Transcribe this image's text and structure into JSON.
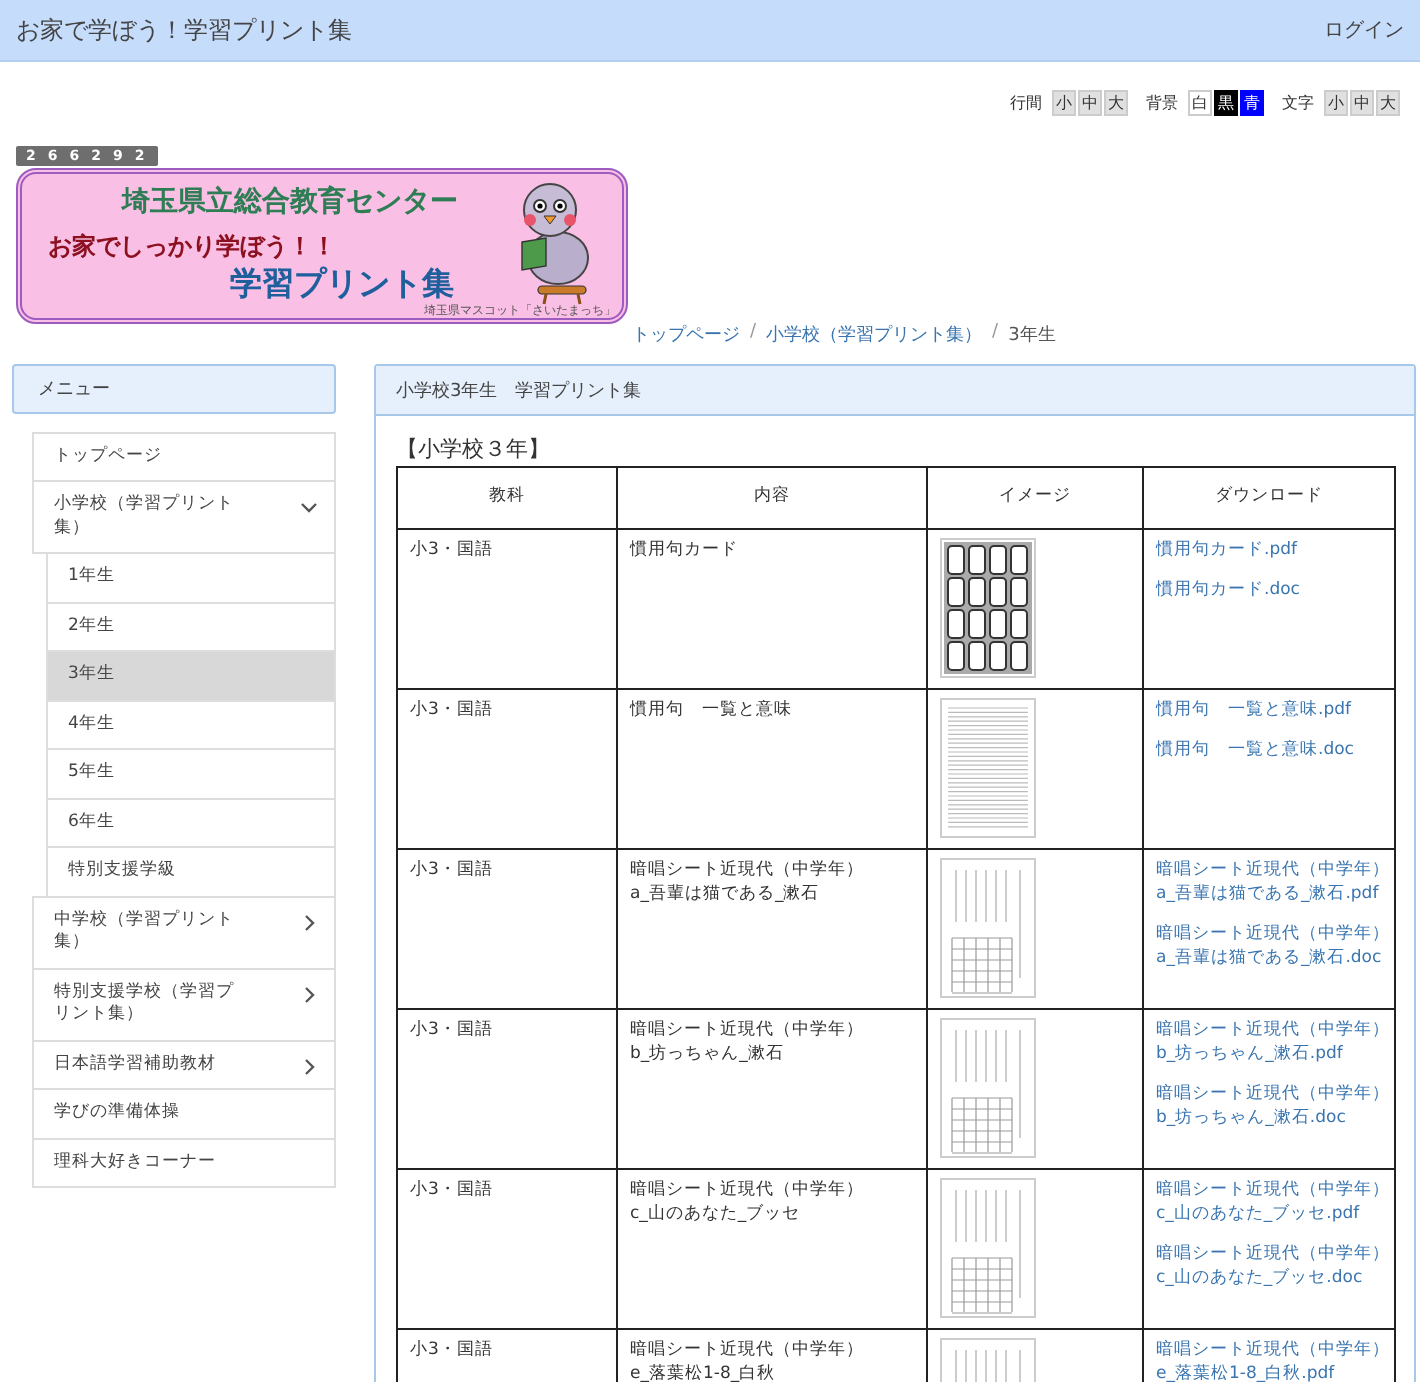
{
  "header": {
    "title": "お家で学ぼう！学習プリント集",
    "login": "ログイン"
  },
  "settings": [
    {
      "label": "行間",
      "options": [
        {
          "text": "小"
        },
        {
          "text": "中"
        },
        {
          "text": "大"
        }
      ]
    },
    {
      "label": "背景",
      "options": [
        {
          "text": "白",
          "color": "#ffffff"
        },
        {
          "text": "黒",
          "color": "#000000"
        },
        {
          "text": "青",
          "color": "#0000ff"
        }
      ]
    },
    {
      "label": "文字",
      "options": [
        {
          "text": "小"
        },
        {
          "text": "中"
        },
        {
          "text": "大"
        }
      ]
    }
  ],
  "counter": "266292",
  "banner": {
    "organization": "埼玉県立総合教育センター",
    "slogan": "お家でしっかり学ぼう！！",
    "title": "学習プリント集",
    "caption": "埼玉県マスコット「さいたまっち」"
  },
  "breadcrumb": {
    "separator": "/",
    "items": [
      "トップページ",
      "小学校（学習プリント集）",
      "3年生"
    ]
  },
  "sidebar": {
    "title": "メニュー",
    "items": [
      {
        "label": "トップページ",
        "kind": "link",
        "selected": false
      },
      {
        "label": "小学校（学習プリント集）",
        "kind": "group",
        "expanded": true,
        "selected": false,
        "children": [
          {
            "label": "1年生",
            "kind": "link",
            "selected": false
          },
          {
            "label": "2年生",
            "kind": "link",
            "selected": false
          },
          {
            "label": "3年生",
            "kind": "link",
            "selected": true
          },
          {
            "label": "4年生",
            "kind": "link",
            "selected": false
          },
          {
            "label": "5年生",
            "kind": "link",
            "selected": false
          },
          {
            "label": "6年生",
            "kind": "link",
            "selected": false
          },
          {
            "label": "特別支援学級",
            "kind": "link",
            "selected": false
          }
        ]
      },
      {
        "label": "中学校（学習プリント集）",
        "kind": "group",
        "expanded": false,
        "selected": false
      },
      {
        "label": "特別支援学校（学習プリント集）",
        "kind": "group",
        "expanded": false,
        "selected": false
      },
      {
        "label": "日本語学習補助教材",
        "kind": "group",
        "expanded": false,
        "selected": false
      },
      {
        "label": "学びの準備体操",
        "kind": "link",
        "selected": false
      },
      {
        "label": "理科大好きコーナー",
        "kind": "link",
        "selected": false
      }
    ]
  },
  "main": {
    "title": "小学校3年生　学習プリント集",
    "heading": "【小学校３年】",
    "table": {
      "columns": [
        "教科",
        "内容",
        "イメージ",
        "ダウンロード"
      ],
      "rows": [
        {
          "subject": "小3・国語",
          "content": [
            "慣用句カード"
          ],
          "kind": "cards",
          "downloads": [
            [
              "慣用句カード.pdf"
            ],
            [
              "慣用句カード.doc"
            ]
          ]
        },
        {
          "subject": "小3・国語",
          "content": [
            "慣用句　一覧と意味"
          ],
          "kind": "list",
          "downloads": [
            [
              "慣用句　一覧と意味.pdf"
            ],
            [
              "慣用句　一覧と意味.doc"
            ]
          ]
        },
        {
          "subject": "小3・国語",
          "content": [
            "暗唱シート近現代（中学年）",
            "a_吾輩は猫である_漱石"
          ],
          "kind": "sheet",
          "downloads": [
            [
              "暗唱シート近現代（中学年）",
              "a_吾輩は猫である_漱石.pdf"
            ],
            [
              "暗唱シート近現代（中学年）",
              "a_吾輩は猫である_漱石.doc"
            ]
          ]
        },
        {
          "subject": "小3・国語",
          "content": [
            "暗唱シート近現代（中学年）",
            "b_坊っちゃん_漱石"
          ],
          "kind": "sheet",
          "downloads": [
            [
              "暗唱シート近現代（中学年）",
              "b_坊っちゃん_漱石.pdf"
            ],
            [
              "暗唱シート近現代（中学年）",
              "b_坊っちゃん_漱石.doc"
            ]
          ]
        },
        {
          "subject": "小3・国語",
          "content": [
            "暗唱シート近現代（中学年）",
            "c_山のあなた_ブッセ"
          ],
          "kind": "sheet",
          "downloads": [
            [
              "暗唱シート近現代（中学年）",
              "c_山のあなた_ブッセ.pdf"
            ],
            [
              "暗唱シート近現代（中学年）",
              "c_山のあなた_ブッセ.doc"
            ]
          ]
        },
        {
          "subject": "小3・国語",
          "content": [
            "暗唱シート近現代（中学年）",
            "e_落葉松1-8_白秋"
          ],
          "kind": "sheet",
          "downloads": [
            [
              "暗唱シート近現代（中学年）",
              "e_落葉松1-8_白秋.pdf"
            ]
          ]
        }
      ]
    }
  }
}
